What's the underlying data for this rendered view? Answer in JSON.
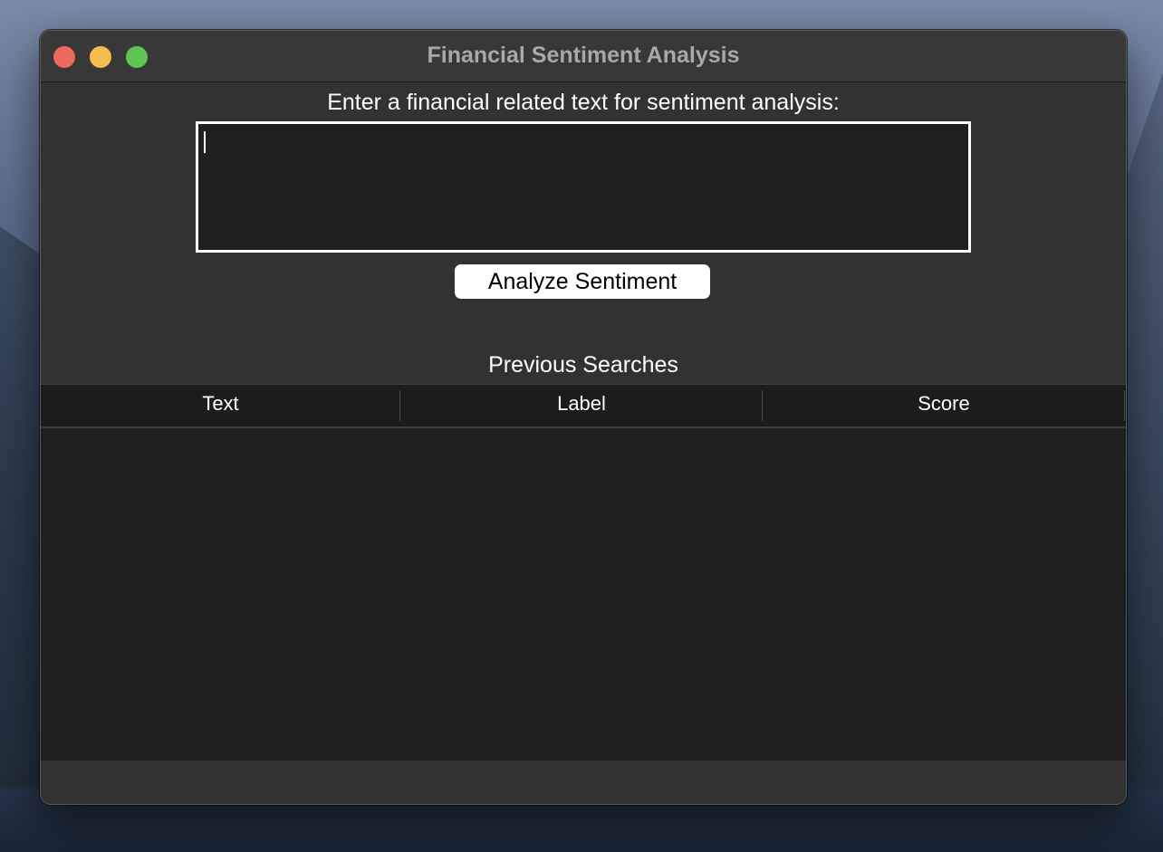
{
  "window": {
    "title": "Financial Sentiment Analysis"
  },
  "form": {
    "prompt": "Enter a financial related text for sentiment analysis:",
    "input_value": "",
    "analyze_label": "Analyze Sentiment"
  },
  "history": {
    "title": "Previous Searches",
    "columns": [
      "Text",
      "Label",
      "Score"
    ],
    "rows": []
  },
  "colors": {
    "close": "#ee6a5f",
    "minimize": "#f5bd4f",
    "zoom": "#61c554",
    "window_bg": "#323232",
    "table_bg": "#1f1f1f"
  }
}
